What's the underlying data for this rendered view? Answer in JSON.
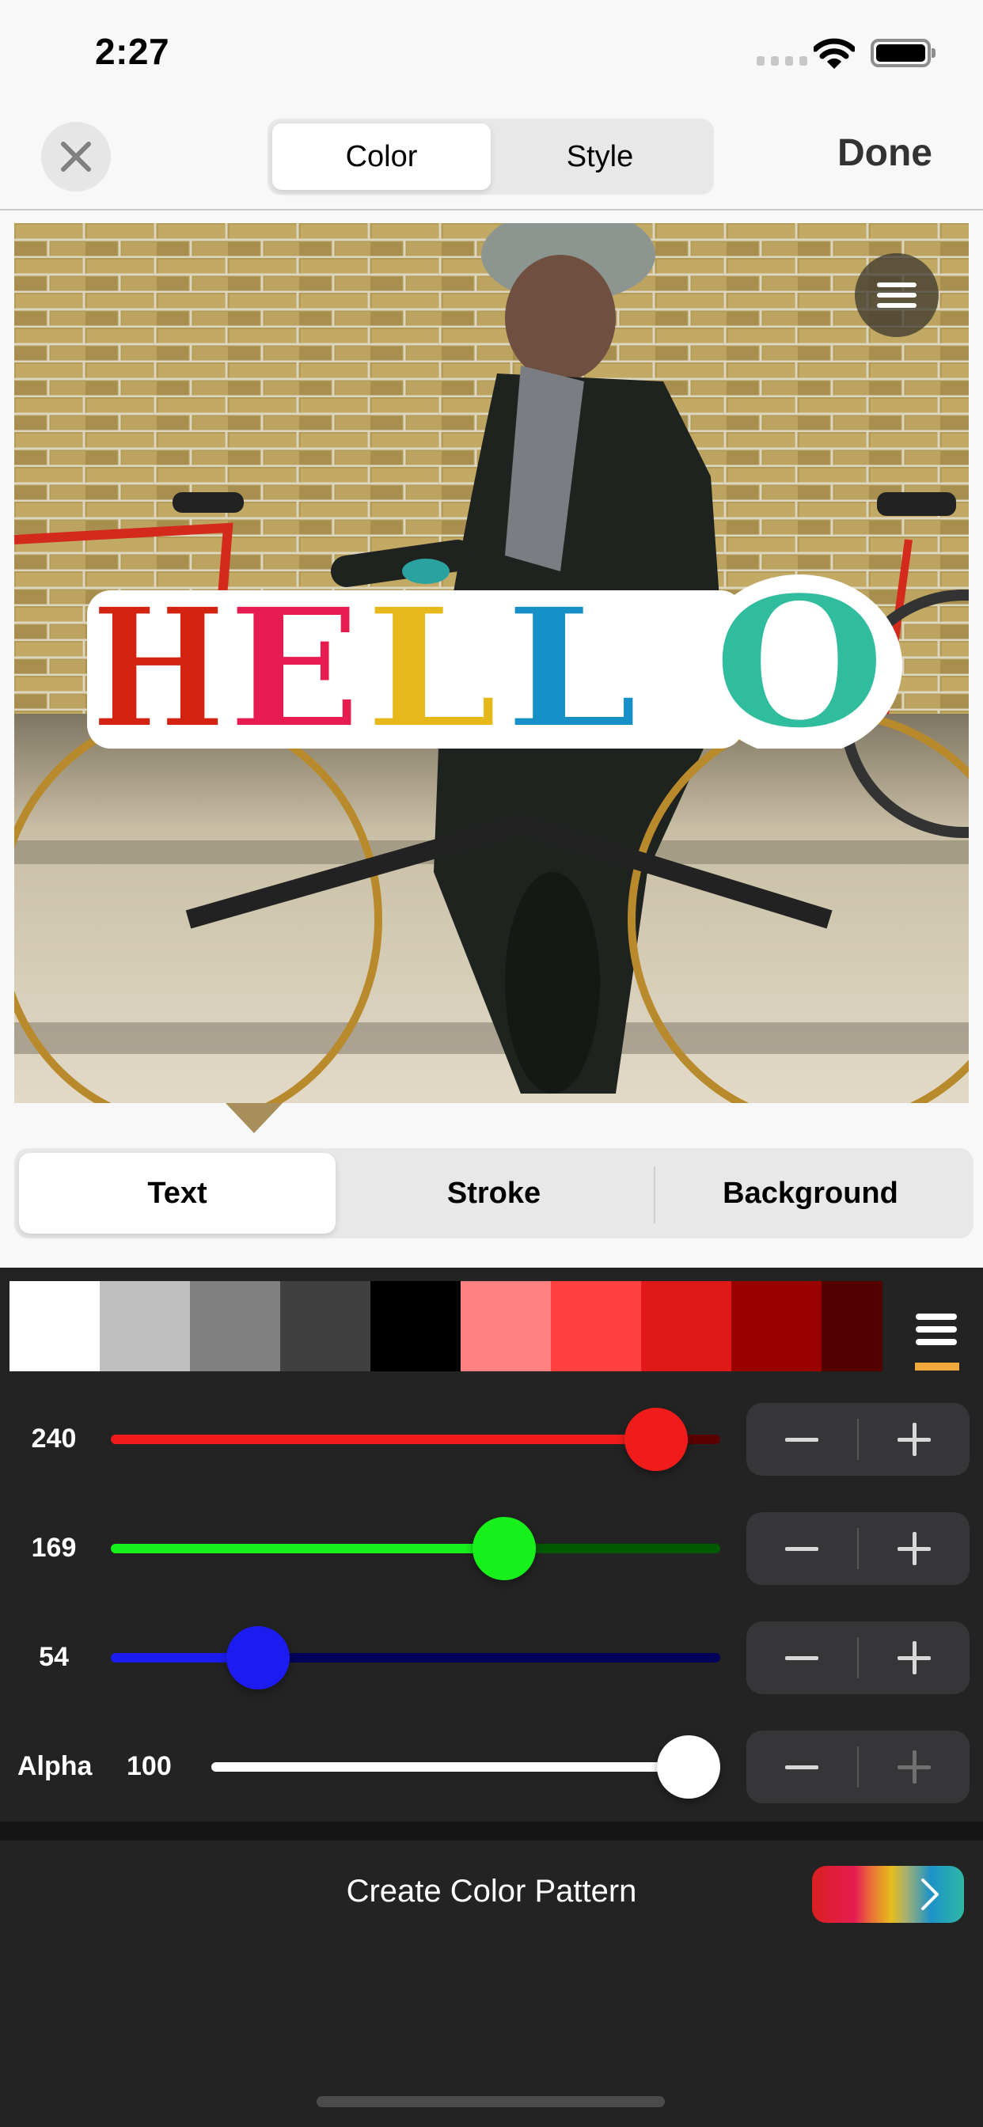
{
  "status_bar": {
    "time": "2:27",
    "icons": [
      "cellular-signal-icon",
      "wifi-icon",
      "battery-icon"
    ]
  },
  "nav": {
    "close_icon": "close-icon",
    "tabs": [
      {
        "label": "Color",
        "active": true
      },
      {
        "label": "Style",
        "active": false
      }
    ],
    "done_label": "Done"
  },
  "canvas": {
    "photo_description": "Woman cycling past bicycles in front of a yellow brick wall",
    "menu_icon": "hamburger-menu-icon",
    "sticker": {
      "text": "HELLO",
      "letters": [
        {
          "char": "H",
          "color": "#d42310"
        },
        {
          "char": "E",
          "color": "#e61c50"
        },
        {
          "char": "L",
          "color": "#e7b81a"
        },
        {
          "char": "L",
          "color": "#1790c8"
        },
        {
          "char": "O",
          "color": "#2fbd9e"
        }
      ],
      "stroke_color": "#ffffff"
    }
  },
  "target_tabs": [
    {
      "label": "Text",
      "active": true
    },
    {
      "label": "Stroke",
      "active": false
    },
    {
      "label": "Background",
      "active": false
    }
  ],
  "palette": {
    "swatches": [
      "#ffffff",
      "#bfbfbf",
      "#808080",
      "#404040",
      "#000000",
      "#ff8080",
      "#ff4040",
      "#e01818",
      "#990000",
      "#550000"
    ],
    "menu_icon": "palette-menu-icon",
    "indicator_color": "#f0a93a"
  },
  "sliders": [
    {
      "id": "red",
      "label": "",
      "value": "240",
      "fraction": 0.941,
      "active_color": "#f01c1c",
      "inactive_color": "#5a0000"
    },
    {
      "id": "green",
      "label": "",
      "value": "169",
      "fraction": 0.663,
      "active_color": "#18f01c",
      "inactive_color": "#005a00"
    },
    {
      "id": "blue",
      "label": "",
      "value": "54",
      "fraction": 0.212,
      "active_color": "#1c1cf0",
      "inactive_color": "#00005a"
    },
    {
      "id": "alpha",
      "label": "Alpha",
      "value": "100",
      "fraction": 1.0,
      "active_color": "#ffffff",
      "inactive_color": "#5a5a5a"
    }
  ],
  "steppers": {
    "minus_icon": "minus-icon",
    "plus_icon": "plus-icon",
    "alpha_plus_disabled": true
  },
  "pattern": {
    "label": "Create Color Pattern",
    "button_icon": "chevron-right-icon"
  }
}
